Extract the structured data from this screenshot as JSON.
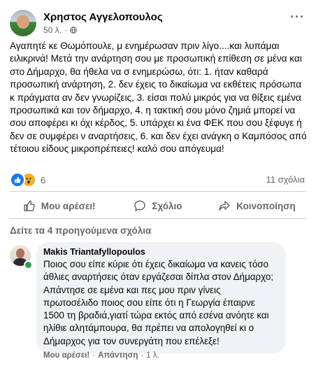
{
  "post": {
    "author": "Χρηστος Αγγελοπουλος",
    "time": "50 λ.",
    "separator": "·",
    "more": "···",
    "text": "Αγαπητέ κε Θωμόπουλε, μ ενημέρωσαν πριν λίγο....και λυπάμαι ειλικρινά! Μετά την ανάρτηση σου με προσωπική επίθεση σε μένα και στο Δήμαρχο, θα ήθελα να σ ενημερώσω, ότι: 1. ήταν καθαρά προσωπική ανάρτηση, 2. δεν έχεις το δικαίωμα να εκθέτεις πρόσωπα κ πράγματα αν δεν γνωρίζεις, 3. είσαι πολύ μικρός για να θίξεις εμένα προσωπικά και τον δήμαρχο, 4. η τακτική σου μόνο ζημιά μπορεί να σου αποφέρει κι όχι κέρδος, 5. υπάρχει κι ένα ΦΕΚ που σου ξέφυγε ή δεν σε συμφέρει ν αναρτήσεις, 6. και δεν έχει ανάγκη ο Καμπόσος από τέτοιου είδους μικροπρέπειες! καλό σου απόγευμα!"
  },
  "reactions": {
    "count": "6",
    "icons": [
      "like-icon",
      "wow-icon"
    ],
    "comments_count": "11 σχόλια"
  },
  "actions": [
    {
      "label": "Μου αρέσει!",
      "icon": "thumbs-up-icon"
    },
    {
      "label": "Σχόλιο",
      "icon": "comment-icon"
    },
    {
      "label": "Κοινοποίηση",
      "icon": "share-icon"
    }
  ],
  "previous_comments": "Δείτε τα 4 προηγούμενα σχόλια",
  "comment": {
    "author": "Makis Triantafyllopoulos",
    "text": "Ποιος σου είπε κύριε ότι έχεις δικαίωμα να κανεις τόσο άθλιες αναρτήσεις όταν εργάζεσαι δίπλα στον Δήμαρχο; Απάντησε σε εμένα και πες μου πριν γίνεις πρωτοσέλιδο ποιος σου είπε ότι η Γεωργία έπαιρνε 1500 τη βραδιά,γιατί τώρα εκτός από εσένα ανόητε και ηλίθιε αλητάμπουρα, θα πρέπει να απολογηθεί κι ο Δήμαρχος για τον συνεργάτη που επέλεξε!",
    "like_label": "Μου αρέσει!",
    "reply_label": "Απάντηση",
    "separator": "·",
    "time": "1 λ."
  },
  "colors": {
    "accent": "#1877f2",
    "wow": "#f7b125",
    "secondary_text": "#65676b",
    "bubble": "#f0f2f5",
    "online": "#31a24c"
  }
}
